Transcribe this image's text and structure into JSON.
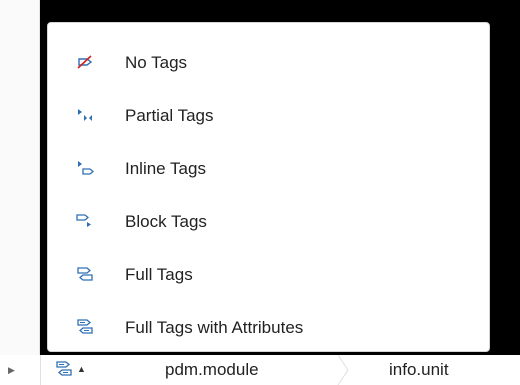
{
  "menu": {
    "items": [
      {
        "label": "No Tags",
        "icon": "no-tags-icon"
      },
      {
        "label": "Partial Tags",
        "icon": "partial-tags-icon"
      },
      {
        "label": "Inline Tags",
        "icon": "inline-tags-icon"
      },
      {
        "label": "Block Tags",
        "icon": "block-tags-icon"
      },
      {
        "label": "Full Tags",
        "icon": "full-tags-icon"
      },
      {
        "label": "Full Tags with Attributes",
        "icon": "full-tags-attributes-icon"
      }
    ]
  },
  "statusbar": {
    "tag_view_icon": "full-tags-attributes-icon",
    "caret_icon": "caret-up-icon",
    "breadcrumbs": [
      "pdm.module",
      "info.unit"
    ]
  },
  "colors": {
    "icon_blue": "#2f6fb3",
    "no_tags_red": "#d02020",
    "background": "#000000",
    "menu_bg": "#ffffff"
  }
}
